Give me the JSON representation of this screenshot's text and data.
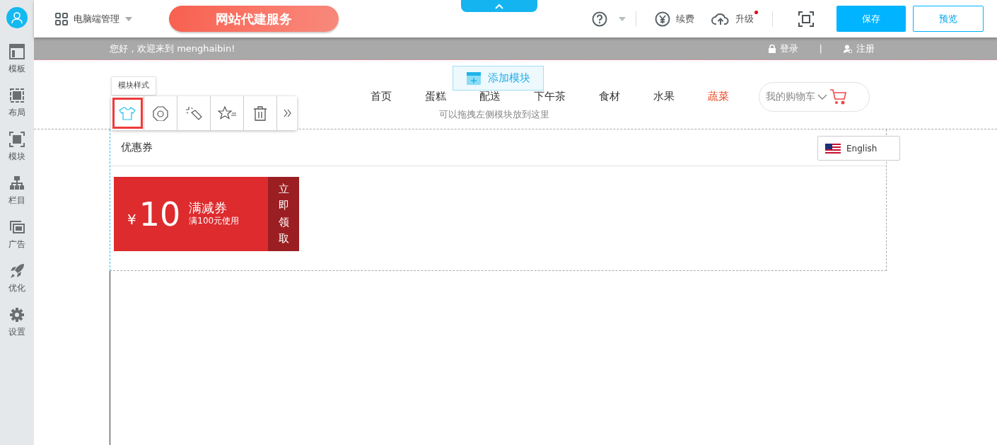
{
  "sidebar": {
    "items": [
      {
        "label": "模板"
      },
      {
        "label": "布局"
      },
      {
        "label": "模块"
      },
      {
        "label": "栏目"
      },
      {
        "label": "广告"
      },
      {
        "label": "优化"
      },
      {
        "label": "设置"
      }
    ]
  },
  "top_bar": {
    "manager": "电脑端管理",
    "promo": "网站代建服务",
    "renew": "续费",
    "upgrade": "升级",
    "upgrade_badge": true,
    "save": "保存",
    "preview": "预览"
  },
  "site": {
    "greeting": "您好，欢迎来到  menghaibin!",
    "login": "登录",
    "separator": "|",
    "register": "注册",
    "nav": [
      {
        "label": "首页",
        "selected": false
      },
      {
        "label": "蛋糕",
        "selected": false
      },
      {
        "label": "配送",
        "selected": false
      },
      {
        "label": "下午茶",
        "selected": false
      },
      {
        "label": "食材",
        "selected": false
      },
      {
        "label": "水果",
        "selected": false
      },
      {
        "label": "蔬菜",
        "selected": true
      }
    ],
    "cart": "我的购物车",
    "add_module": "添加模块",
    "drop_hint": "可以拖拽左侧模块放到这里",
    "module": {
      "title": "优惠券",
      "language": "English",
      "coupon": {
        "currency": "¥",
        "amount": "10",
        "name": "满减券",
        "condition": "满100元使用",
        "claim": "立即领取"
      }
    }
  },
  "module_toolbar": {
    "tooltip": "模块样式",
    "buttons": [
      {
        "selected": true
      },
      {
        "selected": false
      },
      {
        "selected": false
      },
      {
        "selected": false
      },
      {
        "selected": false
      },
      {
        "selected": false
      }
    ]
  }
}
